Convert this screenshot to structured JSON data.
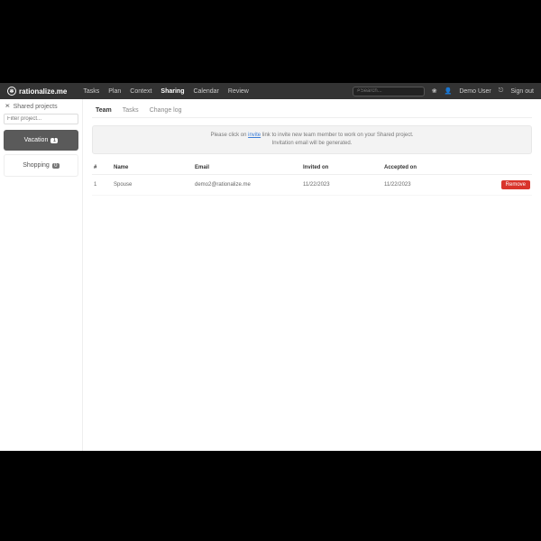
{
  "brand": "rationalize.me",
  "nav": {
    "items": [
      "Tasks",
      "Plan",
      "Context",
      "Sharing",
      "Calendar",
      "Review"
    ],
    "active": "Sharing"
  },
  "search": {
    "placeholder": "Search..."
  },
  "user": {
    "name": "Demo User",
    "signout": "Sign out"
  },
  "sidebar": {
    "title": "Shared projects",
    "filter_placeholder": "Filter project...",
    "projects": [
      {
        "name": "Vacation",
        "count": "1",
        "active": true
      },
      {
        "name": "Shopping",
        "count": "0",
        "active": false
      }
    ]
  },
  "tabs": {
    "items": [
      "Team",
      "Tasks",
      "Change log"
    ],
    "active": "Team"
  },
  "notice": {
    "pre": "Please click on ",
    "link": "invite",
    "post": " link to invite new team member to work on your Shared project.",
    "line2": "Invitation email will be generated."
  },
  "table": {
    "headers": {
      "n": "#",
      "name": "Name",
      "email": "Email",
      "invited": "Invited on",
      "accepted": "Accepted on"
    },
    "rows": [
      {
        "n": "1",
        "name": "Spouse",
        "email": "demo2@rationalize.me",
        "invited": "11/22/2023",
        "accepted": "11/22/2023"
      }
    ],
    "remove": "Remove"
  }
}
